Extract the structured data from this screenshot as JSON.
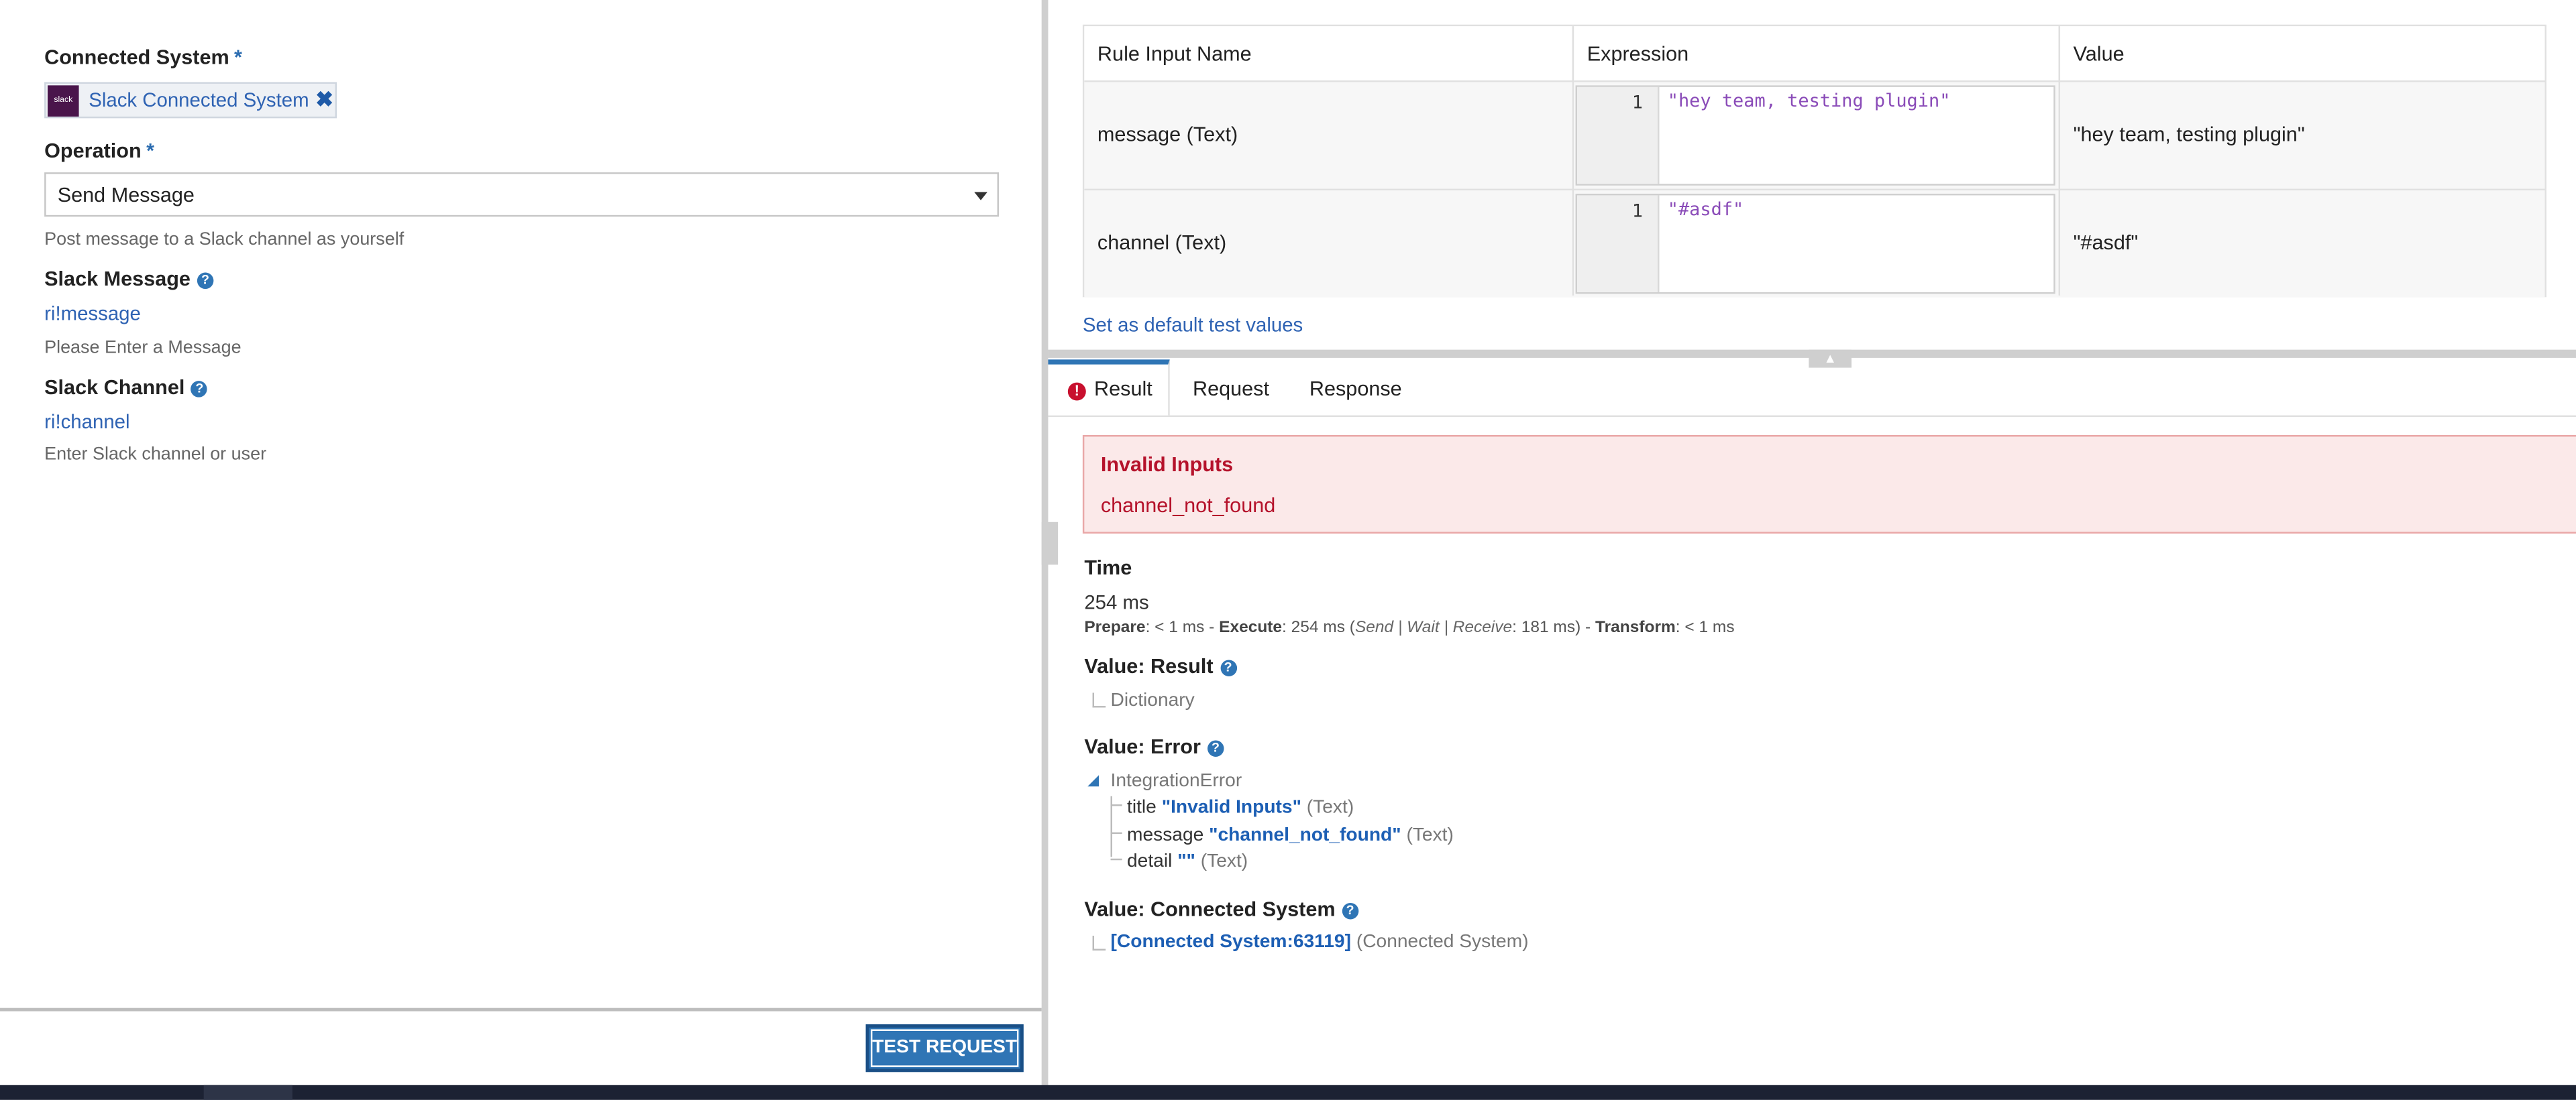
{
  "left": {
    "connected_system": {
      "label": "Connected System",
      "required_mark": "*",
      "chip_text": "Slack Connected System",
      "chip_logo_text": "slack",
      "remove_glyph": "✖"
    },
    "operation": {
      "label": "Operation",
      "required_mark": "*",
      "value": "Send Message",
      "description": "Post message to a Slack channel as yourself"
    },
    "slack_message": {
      "label": "Slack Message",
      "value": "ri!message",
      "hint": "Please Enter a Message"
    },
    "slack_channel": {
      "label": "Slack Channel",
      "value": "ri!channel",
      "hint": "Enter Slack channel or user"
    },
    "help_glyph": "?",
    "test_button": "TEST REQUEST"
  },
  "inputs_table": {
    "headers": [
      "Rule Input Name",
      "Expression",
      "Value"
    ],
    "rows": [
      {
        "name": "message (Text)",
        "line": "1",
        "expression": "\"hey team, testing plugin\"",
        "value": "\"hey team, testing plugin\""
      },
      {
        "name": "channel (Text)",
        "line": "1",
        "expression": "\"#asdf\"",
        "value": "\"#asdf\""
      }
    ],
    "set_default_link": "Set as default test values"
  },
  "tabs": [
    {
      "label": "Result",
      "active": true,
      "icon": "error-icon"
    },
    {
      "label": "Request",
      "active": false
    },
    {
      "label": "Response",
      "active": false
    }
  ],
  "result": {
    "error": {
      "title": "Invalid Inputs",
      "message": "channel_not_found"
    },
    "time": {
      "label": "Time",
      "total": "254 ms",
      "prepare_label": "Prepare",
      "prepare_value": ": < 1 ms - ",
      "execute_label": "Execute",
      "execute_value": ": 254 ms (",
      "swr_label": "Send | Wait | Receive",
      "swr_value": ": 181 ms) - ",
      "transform_label": "Transform",
      "transform_value": ": < 1 ms"
    },
    "value_result": {
      "label": "Value: Result",
      "item": "Dictionary"
    },
    "value_error": {
      "label": "Value: Error",
      "root": "IntegrationError",
      "fields": [
        {
          "key": "title",
          "value": "\"Invalid Inputs\"",
          "type": "(Text)"
        },
        {
          "key": "message",
          "value": "\"channel_not_found\"",
          "type": "(Text)"
        },
        {
          "key": "detail",
          "value": "\"\"",
          "type": "(Text)"
        }
      ]
    },
    "value_connected_system": {
      "label": "Value: Connected System",
      "link": "[Connected System:63119]",
      "type": "(Connected System)"
    }
  },
  "colors": {
    "accent": "#2f75b5",
    "error": "#b5122b",
    "error_bg": "#fbe9e9",
    "taskbar": "#1c2233"
  }
}
